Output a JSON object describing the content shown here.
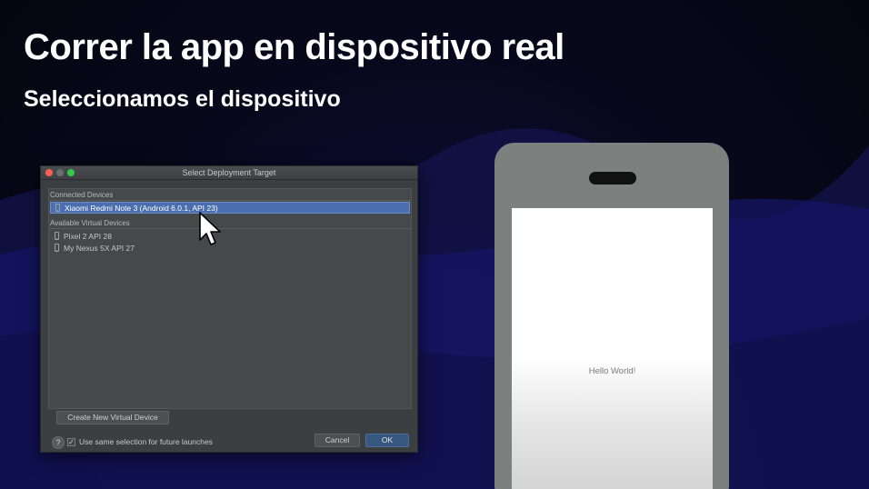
{
  "slide": {
    "title": "Correr la app en dispositivo real",
    "subtitle": "Seleccionamos el dispositivo"
  },
  "dialog": {
    "title": "Select Deployment Target",
    "connected_header": "Connected Devices",
    "connected_devices": [
      {
        "label": "Xiaomi Redmi Note 3 (Android 6.0.1, API 23)",
        "selected": true
      }
    ],
    "virtual_header": "Available Virtual Devices",
    "virtual_devices": [
      {
        "label": "Pixel 2 API 28"
      },
      {
        "label": "My Nexus 5X API 27"
      }
    ],
    "create_button": "Create New Virtual Device",
    "help_label": "?",
    "checkbox_label": "Use same selection for future launches",
    "checkbox_checked": true,
    "checkbox_mark": "✓",
    "cancel_button": "Cancel",
    "ok_button": "OK"
  },
  "phone": {
    "screen_text": "Hello World!"
  },
  "colors": {
    "selection": "#4b6eaf",
    "dialog_bg": "#3c3f41",
    "ok_button": "#365880"
  }
}
